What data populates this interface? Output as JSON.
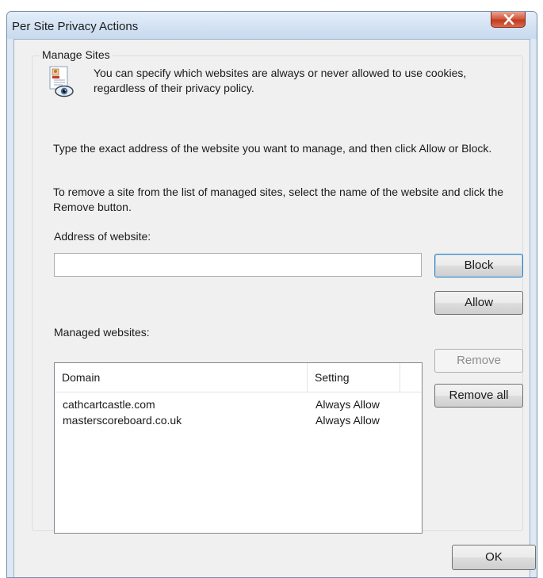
{
  "window": {
    "title": "Per Site Privacy Actions"
  },
  "manage_sites": {
    "group_label": "Manage Sites",
    "intro_text": "You can specify which websites are always or never allowed to use cookies, regardless of their privacy policy.",
    "instructions_add": "Type the exact address of the website you want to manage, and then click Allow or Block.",
    "instructions_remove": "To remove a site from the list of managed sites, select the name of the website and click the Remove button."
  },
  "address": {
    "label": "Address of website:",
    "value": ""
  },
  "buttons": {
    "block": "Block",
    "allow": "Allow",
    "remove": "Remove",
    "remove_all": "Remove all",
    "ok": "OK"
  },
  "managed": {
    "label": "Managed websites:",
    "columns": [
      "Domain",
      "Setting"
    ],
    "rows": [
      {
        "domain": "cathcartcastle.com",
        "setting": "Always Allow"
      },
      {
        "domain": "masterscoreboard.co.uk",
        "setting": "Always Allow"
      }
    ]
  },
  "icons": {
    "close": "close-icon",
    "privacy": "privacy-cookie-icon"
  }
}
